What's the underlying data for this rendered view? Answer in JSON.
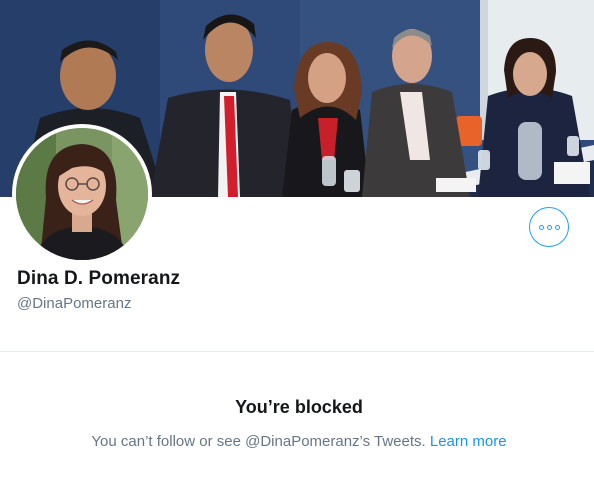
{
  "profile": {
    "display_name": "Dina D. Pomeranz",
    "handle": "@DinaPomeranz"
  },
  "actions": {
    "more_icon": "more-dots-icon"
  },
  "blocked": {
    "title": "You’re blocked",
    "message": "You can’t follow or see @DinaPomeranz’s Tweets.",
    "link_label": "Learn more"
  },
  "colors": {
    "accent": "#1da1f2",
    "link": "#1b95e0",
    "text_primary": "#14171a",
    "text_secondary": "#657786",
    "divider": "#e6ecf0"
  }
}
